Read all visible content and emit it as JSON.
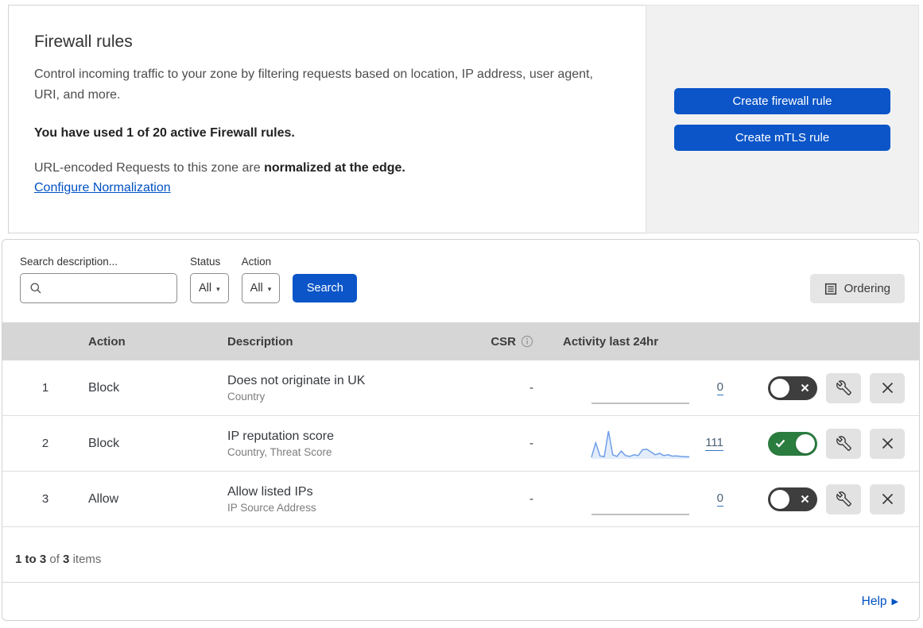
{
  "header": {
    "title": "Firewall rules",
    "description": "Control incoming traffic to your zone by filtering requests based on location, IP address, user agent, URI, and more.",
    "usage_text": "You have used 1 of 20 active Firewall rules.",
    "normalization_prefix": "URL-encoded Requests to this zone are ",
    "normalization_bold": "normalized at the edge.",
    "normalization_link": "Configure Normalization",
    "create_firewall_button": "Create firewall rule",
    "create_mtls_button": "Create mTLS rule"
  },
  "filters": {
    "search_label": "Search description...",
    "status_label": "Status",
    "status_value": "All",
    "action_label": "Action",
    "action_value": "All",
    "search_button": "Search",
    "ordering_button": "Ordering"
  },
  "table": {
    "headers": {
      "action": "Action",
      "description": "Description",
      "csr": "CSR",
      "activity": "Activity last 24hr"
    },
    "rows": [
      {
        "priority": "1",
        "action": "Block",
        "description": "Does not originate in UK",
        "match_fields": "Country",
        "csr": "-",
        "activity_count": "0",
        "enabled": false,
        "activity_series": [
          0,
          0,
          0,
          0,
          0,
          0,
          0,
          0,
          0,
          0,
          0,
          0,
          0,
          0,
          0,
          0,
          0,
          0,
          0,
          0,
          0,
          0,
          0,
          0
        ]
      },
      {
        "priority": "2",
        "action": "Block",
        "description": "IP reputation score",
        "match_fields": "Country, Threat Score",
        "csr": "-",
        "activity_count": "111",
        "enabled": true,
        "activity_series": [
          3,
          55,
          8,
          5,
          97,
          12,
          6,
          25,
          9,
          6,
          12,
          9,
          30,
          32,
          22,
          12,
          17,
          9,
          12,
          7,
          8,
          6,
          5,
          5
        ]
      },
      {
        "priority": "3",
        "action": "Allow",
        "description": "Allow listed IPs",
        "match_fields": "IP Source Address",
        "csr": "-",
        "activity_count": "0",
        "enabled": false,
        "activity_series": [
          0,
          0,
          0,
          0,
          0,
          0,
          0,
          0,
          0,
          0,
          0,
          0,
          0,
          0,
          0,
          0,
          0,
          0,
          0,
          0,
          0,
          0,
          0,
          0
        ]
      }
    ]
  },
  "footer": {
    "range": "1 to 3",
    "of": "of",
    "total": "3",
    "items": "items",
    "help_label": "Help"
  },
  "icons": {
    "caret": "▾",
    "help_arrow": "▶"
  },
  "colors": {
    "primary_blue": "#0b55c8",
    "link_blue": "#0051c3",
    "toggle_on_green": "#2b7c3f",
    "toggle_off_gray": "#3e3e3e",
    "sparkline_line": "#6f9ee8",
    "sparkline_fill": "#e3edfa",
    "flatline_gray": "#9b9b9b",
    "side_panel_bg": "#f1f1f2",
    "table_header_bg": "#d6d6d6"
  }
}
